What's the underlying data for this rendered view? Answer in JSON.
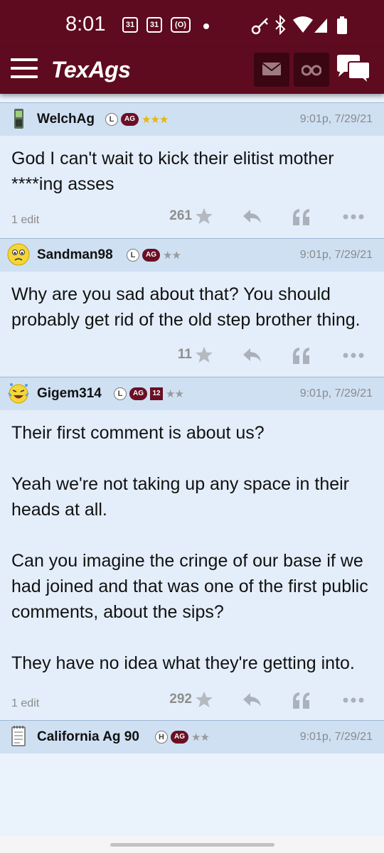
{
  "status_bar": {
    "time": "8:01",
    "cal1": "31",
    "cal2": "31",
    "rec": "(O)"
  },
  "app": {
    "title": "TexAgs"
  },
  "colors": {
    "brand": "#5e0b1f",
    "header_bg": "#cfe0f3",
    "body_bg": "#e4eefa",
    "star_gold": "#e6b800"
  },
  "posts": [
    {
      "avatar_icon": "phone-icon",
      "username": "WelchAg",
      "badge_l": "L",
      "badge_ag": "AG",
      "stars": "★★★",
      "timestamp": "9:01p, 7/29/21",
      "body": "God I can't wait to kick their elitist mother ****ing asses",
      "edit_note": "1 edit",
      "rating": "261"
    },
    {
      "avatar_icon": "sad-face-icon",
      "username": "Sandman98",
      "badge_l": "L",
      "badge_ag": "AG",
      "stars": "★★",
      "timestamp": "9:01p, 7/29/21",
      "body": "Why are you sad about that? You should probably get rid of the old step brother thing.",
      "edit_note": "",
      "rating": "11"
    },
    {
      "avatar_icon": "laughing-face-icon",
      "username": "Gigem314",
      "badge_l": "L",
      "badge_ag": "AG",
      "badge_12": "12",
      "stars": "★★",
      "timestamp": "9:01p, 7/29/21",
      "body": "Their first comment is about us?\n\nYeah we're not taking up any space in their heads at all.\n\nCan you imagine the cringe of our base if we had joined and that was one of the first public comments, about the sips?\n\nThey have no idea what they're getting into.",
      "edit_note": "1 edit",
      "rating": "292"
    },
    {
      "avatar_icon": "notepad-icon",
      "username": "California Ag 90",
      "badge_h": "H",
      "badge_ag": "AG",
      "stars": "★★",
      "timestamp": "9:01p, 7/29/21"
    }
  ]
}
